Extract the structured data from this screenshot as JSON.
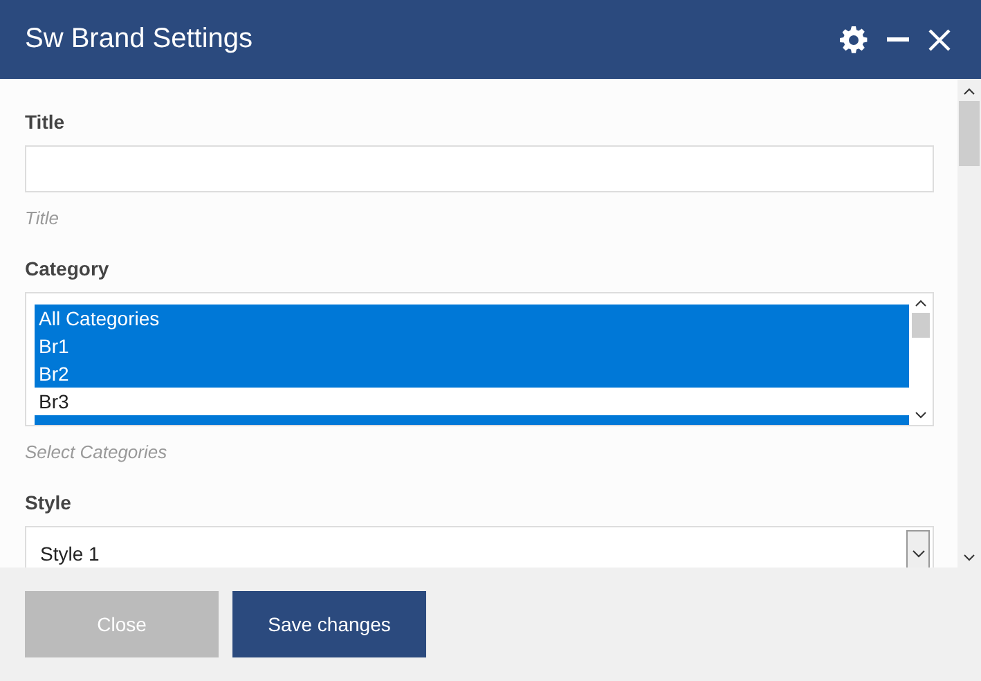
{
  "window": {
    "title": "Sw Brand Settings"
  },
  "fields": [
    {
      "kind": "text",
      "label": "Title",
      "hint": "Title"
    },
    {
      "kind": "listbox",
      "label": "Category",
      "hint": "Select Categories",
      "items": [
        {
          "label": "All Categories",
          "selected": true
        },
        {
          "label": "Br1",
          "selected": true
        },
        {
          "label": "Br2",
          "selected": true
        },
        {
          "label": "Br3",
          "selected": false
        }
      ],
      "cut_item_selected": true
    },
    {
      "kind": "select",
      "label": "Style",
      "value": "Style 1"
    }
  ],
  "buttons": [
    {
      "label": "Close",
      "kind": "secondary"
    },
    {
      "label": "Save changes",
      "kind": "primary"
    }
  ]
}
